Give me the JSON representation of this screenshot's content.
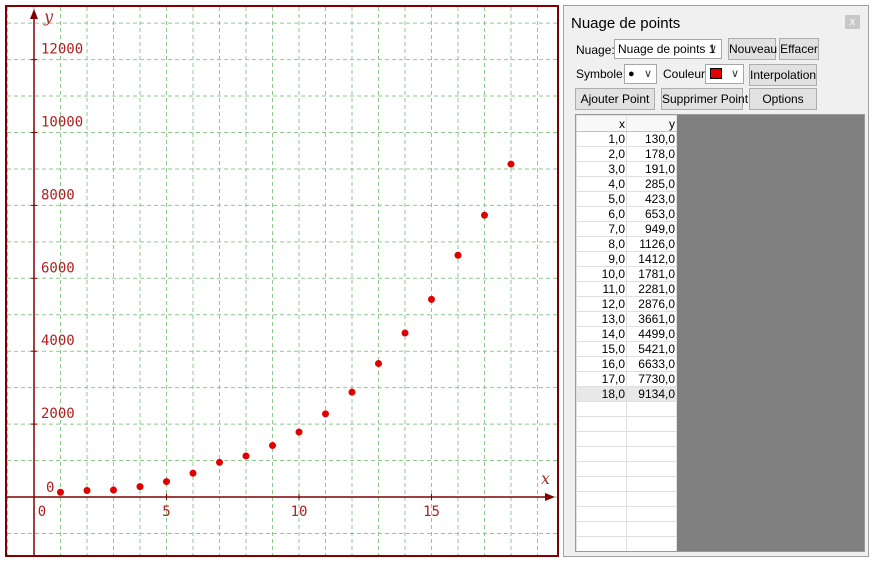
{
  "graph": {
    "x_axis_label": "x",
    "y_axis_label": "y",
    "x_ticks": [
      "0",
      "5",
      "10",
      "15"
    ],
    "y_ticks": [
      "0",
      "2000",
      "4000",
      "6000",
      "8000",
      "10000",
      "12000"
    ]
  },
  "chart_data": {
    "type": "scatter",
    "xlabel": "x",
    "ylabel": "y",
    "xlim": [
      -1,
      19.5
    ],
    "ylim": [
      -1500,
      13400
    ],
    "grid": true,
    "point_color": "#e00000",
    "x": [
      1,
      2,
      3,
      4,
      5,
      6,
      7,
      8,
      9,
      10,
      11,
      12,
      13,
      14,
      15,
      16,
      17,
      18
    ],
    "y": [
      130,
      178,
      191,
      285,
      423,
      653,
      949,
      1126,
      1412,
      1781,
      2281,
      2876,
      3661,
      4499,
      5421,
      6633,
      7730,
      9134
    ]
  },
  "panel": {
    "title": "Nuage de points",
    "close_label": "x",
    "nuage_label": "Nuage:",
    "nuage_value": "Nuage de points 1",
    "nouveau_label": "Nouveau",
    "effacer_label": "Effacer",
    "symbole_label": "Symbole:",
    "symbole_value": "●",
    "couleur_label": "Couleur:",
    "couleur_value": "#e00000",
    "interpolation_label": "Interpolation",
    "ajouter_label": "Ajouter Point",
    "supprimer_label": "Supprimer Point",
    "options_label": "Options",
    "dropdown_arrow": "∨"
  },
  "table": {
    "headers": [
      "x",
      "y"
    ],
    "rows": [
      [
        "1,0",
        "130,0"
      ],
      [
        "2,0",
        "178,0"
      ],
      [
        "3,0",
        "191,0"
      ],
      [
        "4,0",
        "285,0"
      ],
      [
        "5,0",
        "423,0"
      ],
      [
        "6,0",
        "653,0"
      ],
      [
        "7,0",
        "949,0"
      ],
      [
        "8,0",
        "1126,0"
      ],
      [
        "9,0",
        "1412,0"
      ],
      [
        "10,0",
        "1781,0"
      ],
      [
        "11,0",
        "2281,0"
      ],
      [
        "12,0",
        "2876,0"
      ],
      [
        "13,0",
        "3661,0"
      ],
      [
        "14,0",
        "4499,0"
      ],
      [
        "15,0",
        "5421,0"
      ],
      [
        "16,0",
        "6633,0"
      ],
      [
        "17,0",
        "7730,0"
      ],
      [
        "18,0",
        "9134,0"
      ]
    ],
    "empty_rows": 10
  }
}
